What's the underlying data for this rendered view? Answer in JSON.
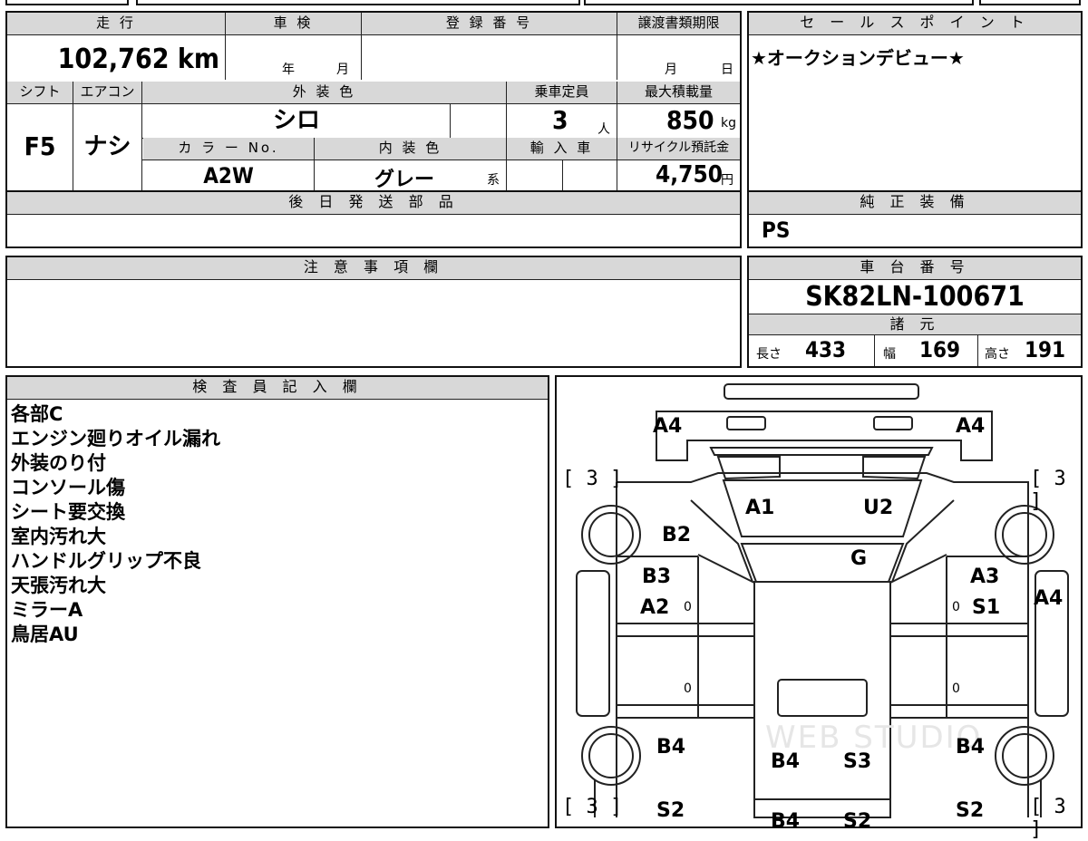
{
  "header_row": {
    "row1": "走 行",
    "row2": "車 検",
    "row3": "登 録 番 号",
    "row4": "譲渡書類期限",
    "sales_header": "セ ー ル ス ポ イ ン ト"
  },
  "mileage": {
    "value": "102,762",
    "unit": "km"
  },
  "shaken": {
    "year": "年",
    "month": "月"
  },
  "deadline": {
    "month": "月",
    "day": "日"
  },
  "sales_point": "★オークションデビュー★",
  "labels": {
    "shift": "シフト",
    "aircon": "エアコン",
    "exterior": "外 装 色",
    "capacity": "乗車定員",
    "maxload": "最大積載量",
    "color_no": "カ ラ ー No.",
    "interior": "内 装 色",
    "import": "輸 入 車",
    "recycle": "リサイクル預託金",
    "later_parts": "後 日 発 送 部 品",
    "genuine": "純 正 装 備",
    "notes": "注 意 事 項 欄",
    "chassis": "車 台 番 号",
    "specs": "諸 元",
    "inspector": "検 査 員 記 入 欄"
  },
  "values": {
    "shift": "F5",
    "aircon": "ナシ",
    "exterior_color": "シロ",
    "capacity": "3",
    "capacity_unit": "人",
    "maxload": "850",
    "maxload_unit": "kg",
    "color_no": "A2W",
    "interior_color": "グレー",
    "interior_suffix": "系",
    "recycle": "4,750",
    "recycle_unit": "円",
    "genuine": "PS",
    "chassis": "SK82LN-100671"
  },
  "specs": {
    "length_label": "長さ",
    "length": "433",
    "width_label": "幅",
    "width": "169",
    "height_label": "高さ",
    "height": "191"
  },
  "inspector_notes": [
    "各部C",
    "エンジン廻りオイル漏れ",
    "外装のり付",
    "コンソール傷",
    "シート要交換",
    "室内汚れ大",
    "ハンドルグリップ不良",
    "天張汚れ大",
    "ミラーA",
    "鳥居AU"
  ],
  "diagram": {
    "marks": {
      "a4_tl": "A4",
      "a4_tr": "A4",
      "a1": "A1",
      "u2": "U2",
      "b2": "B2",
      "g": "G",
      "b3": "B3",
      "a3": "A3",
      "a2": "A2",
      "s1": "S1",
      "a4_r": "A4",
      "b4_l": "B4",
      "b4_c": "B4",
      "s3": "S3",
      "b4_r": "B4",
      "s2_l": "S2",
      "s2_r": "S2",
      "b4_b": "B4",
      "s2_b": "S2"
    },
    "tire": {
      "tl": "[ 3 ]",
      "tr": "[ 3 ]",
      "bl": "[ 3 ]",
      "br": "[ 3 ]"
    },
    "zero": "0",
    "watermark": "WEB STUDIO"
  }
}
